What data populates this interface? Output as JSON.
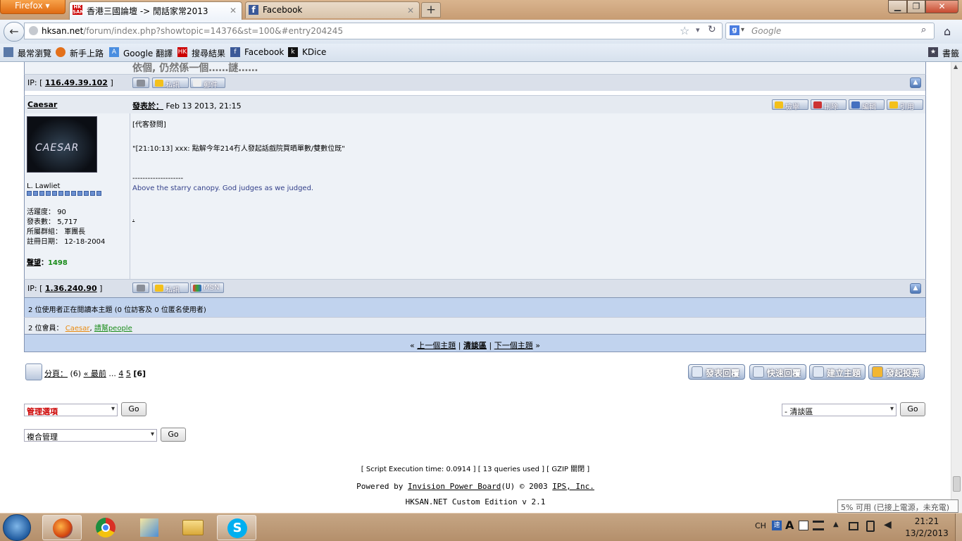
{
  "browser": {
    "firefox_label": "Firefox",
    "tabs": [
      {
        "label": "香港三國論壇 -> 閒話家常2013",
        "active": true
      },
      {
        "label": "Facebook",
        "active": false
      }
    ],
    "url": {
      "host": "hksan.net",
      "path": "/forum/index.php?showtopic=14376&st=100&#entry204245"
    },
    "search_placeholder": "Google",
    "bookmarks": [
      "最常瀏覽",
      "新手上路",
      "Google 翻譯",
      "搜尋結果",
      "Facebook",
      "KDice"
    ],
    "bookmarks_menu": "書籤"
  },
  "prev_post": {
    "cut_text": "依個, 仍然係一個……謎……",
    "ip_label": "IP: [",
    "ip": "116.49.39.102",
    "ip_close": "]",
    "btn_pm": "私訊",
    "btn_mail": "郵件"
  },
  "post": {
    "author": "Caesar",
    "posted_label": "發表於：",
    "posted_time": "Feb 13 2013, 21:15",
    "actions": [
      "檢舉",
      "刪除",
      "編輯",
      "引用"
    ],
    "avatar_text": "CAESAR",
    "member_title": "L. Lawliet",
    "stats": [
      {
        "label": "活躍度：",
        "value": "90"
      },
      {
        "label": "發表數：",
        "value": "5,717"
      },
      {
        "label": "所屬群組：",
        "value": "軍團長"
      },
      {
        "label": "註冊日期：",
        "value": "12-18-2004"
      }
    ],
    "rep_label": "聲望",
    "rep_colon": "：",
    "rep_value": "1498",
    "body_line1": "[代客發問]",
    "body_line2": "\"[21:10:13] xxx: 點解今年214冇人發起話戲院買晒單數/雙數位既\"",
    "sig_divider": "--------------------",
    "signature": "Above the starry canopy. God judges as we judged.",
    "sig_dot": ".",
    "ip_label": "IP: [",
    "ip": "1.36.240.90",
    "ip_close": "]",
    "btn_pm": "私訊",
    "btn_msn": "MSN"
  },
  "active_users": {
    "summary": "2 位使用者正在閱讀本主題 (0 位訪客及 0 位匿名使用者)",
    "members_label": "2 位會員：",
    "member1": "Caesar",
    "sep": ",",
    "member2": "請幫people"
  },
  "topic_nav": {
    "prefix": "«",
    "prev": "上一個主題",
    "sep": "|",
    "forum": "清談區",
    "next": "下一個主題",
    "suffix": "»"
  },
  "pagination": {
    "label": "分頁：",
    "total": "(6)",
    "first": "« 最前",
    "ellipsis": "...",
    "pages": [
      "4",
      "5"
    ],
    "current": "[6]"
  },
  "action_buttons": [
    "發表回覆",
    "快速回覆",
    "建立主題",
    "發起投票"
  ],
  "mod": {
    "select1": "管理選項",
    "go": "Go",
    "select2": "複合管理",
    "forum_jump": "- 清談區"
  },
  "footer": {
    "stats": "[ Script Execution time: 0.0914 ]   [ 13 queries used ]   [ GZIP 關閉 ]",
    "powered_prefix": "Powered by",
    "ipb": "Invision Power Board",
    "powered_mid": "(U) © 2003",
    "ips": "IPS, Inc.",
    "edition": "HKSAN.NET Custom Edition v 2.1"
  },
  "tooltip": "5% 可用 (已接上電源，未充電)",
  "tray": {
    "lang": "CH",
    "time": "21:21",
    "date": "13/2/2013"
  },
  "colors": {
    "member_link": "#e98a0f",
    "member2_link": "#1a8c1a",
    "rep_value": "#1a8c1a",
    "signature": "#33408a"
  }
}
